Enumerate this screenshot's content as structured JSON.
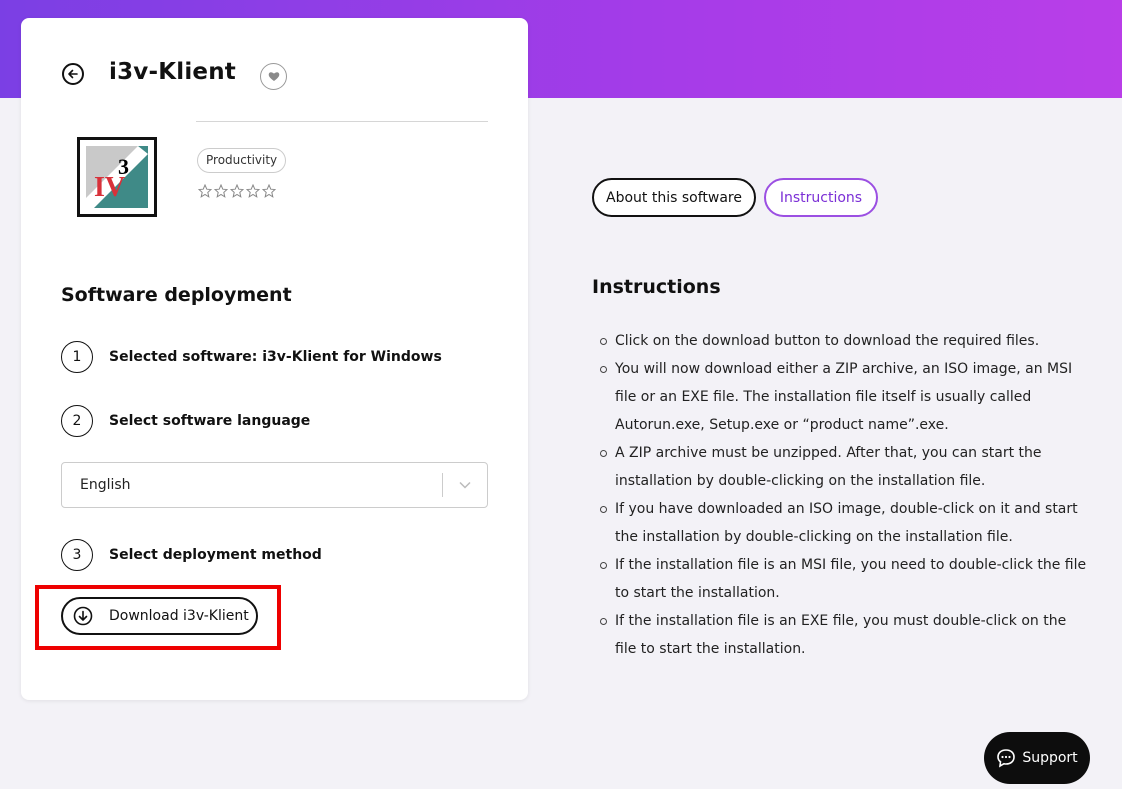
{
  "app": {
    "title": "i3v-Klient",
    "category": "Productivity",
    "rating": 0,
    "logo_text_top": "3",
    "logo_text_bottom": "IV"
  },
  "deployment": {
    "heading": "Software deployment",
    "steps": [
      {
        "number": "1",
        "label": "Selected software: i3v-Klient for Windows"
      },
      {
        "number": "2",
        "label": "Select software language"
      },
      {
        "number": "3",
        "label": "Select deployment method"
      }
    ],
    "language_select": {
      "value": "English"
    },
    "download_button": {
      "label": "Download i3v-Klient"
    }
  },
  "tabs": [
    {
      "label": "About this software",
      "active": false
    },
    {
      "label": "Instructions",
      "active": true
    }
  ],
  "instructions": {
    "heading": "Instructions",
    "items": [
      "Click on the download button to download the required files.",
      "You will now download either a ZIP archive, an ISO image, an MSI file or an EXE file. The installation file itself is usually called Autorun.exe, Setup.exe or “product name”.exe.",
      "A ZIP archive must be unzipped. After that, you can start the installation by double-clicking on the installation file.",
      "If you have downloaded an ISO image, double-click on it and start the installation by double-clicking on the installation file.",
      "If the installation file is an MSI file, you need to double-click the file to start the installation.",
      "If the installation file is an EXE file, you must double-click on the file to start the installation."
    ]
  },
  "support": {
    "label": "Support"
  },
  "colors": {
    "accent": "#9b4fe2",
    "hero_start": "#7b3fe4",
    "hero_end": "#b93ee8",
    "highlight": "#e00000",
    "logo_teal": "#3f8a87",
    "logo_red": "#d8313a"
  },
  "icons": {
    "back": "back-arrow-circle-icon",
    "favorite": "heart-icon",
    "star": "star-outline-icon",
    "dropdown": "chevron-down-icon",
    "download": "download-arrow-circle-icon",
    "support": "chat-bubble-icon"
  }
}
